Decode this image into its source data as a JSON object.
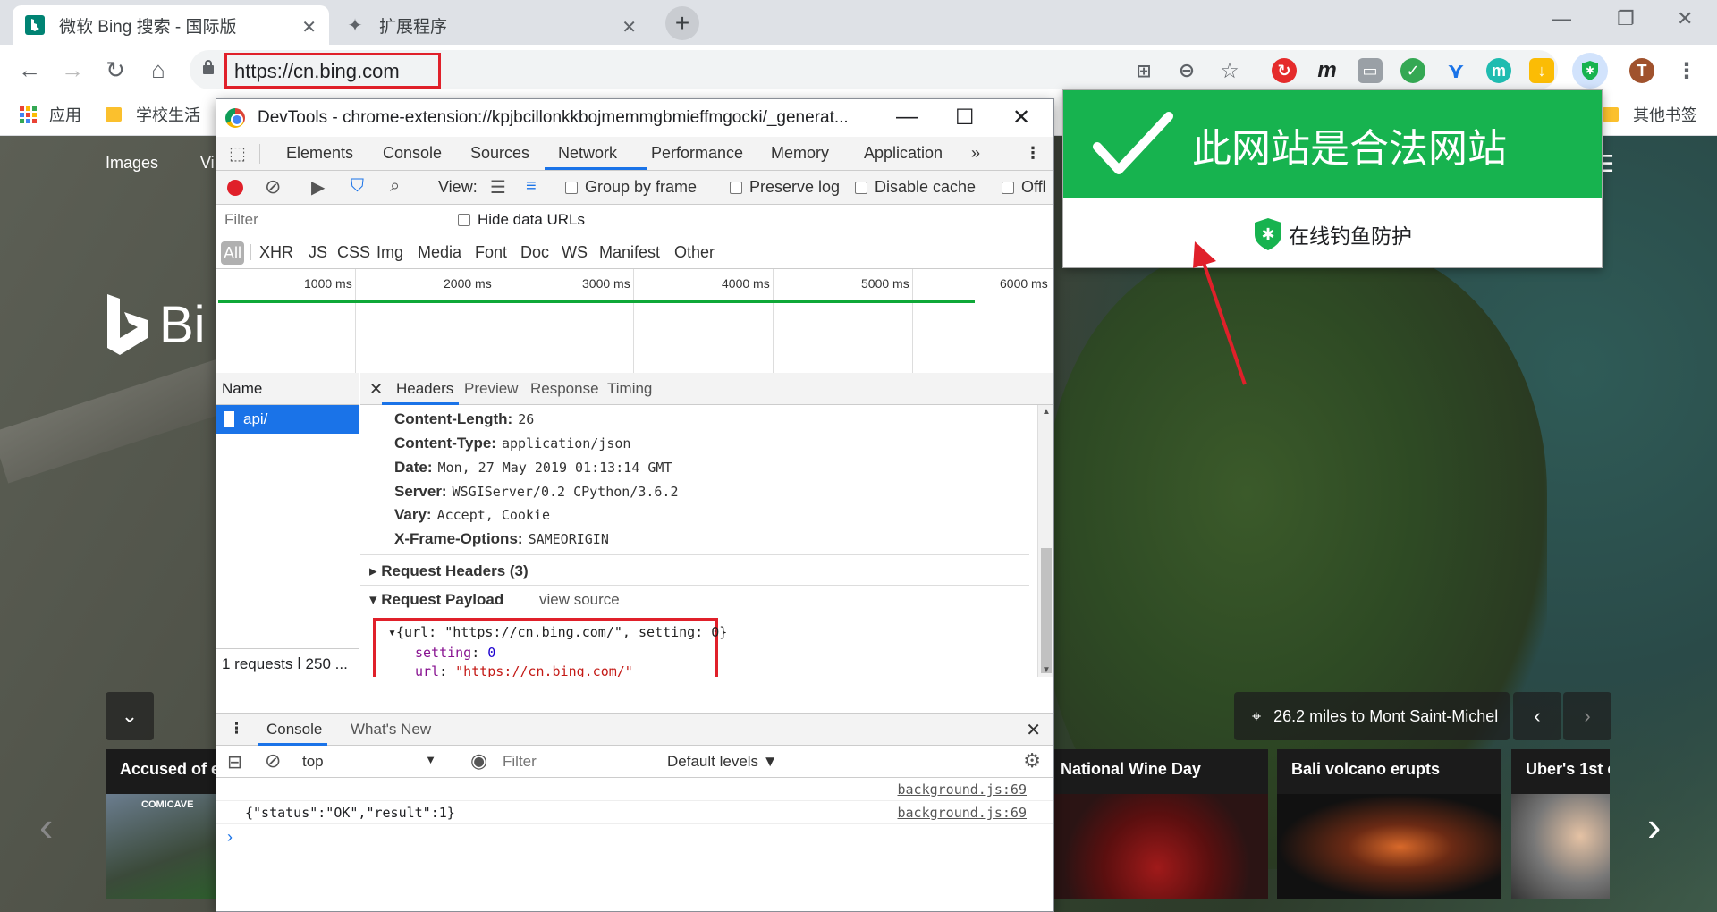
{
  "tabs": [
    {
      "title": "微软 Bing 搜索 - 国际版",
      "close": "✕"
    },
    {
      "title": "扩展程序",
      "close": "✕"
    }
  ],
  "window_controls": {
    "minimize": "—",
    "restore": "❐",
    "close": "✕"
  },
  "address_bar": {
    "url": "https://cn.bing.com"
  },
  "bookmarks": {
    "apps": "应用",
    "school": "学校生活",
    "other": "其他书签"
  },
  "profile_initial": "T",
  "bing": {
    "nav_images": "Images",
    "nav_video_partial": "Vi",
    "logo_partial": "Bi",
    "location_text": "26.2 miles to Mont Saint-Michel",
    "cards": [
      {
        "title": "Accused of el",
        "tag": "COMICAVE"
      },
      {
        "title": "National Wine Day"
      },
      {
        "title": "Bali volcano erupts"
      },
      {
        "title": "Uber's 1st e"
      }
    ]
  },
  "devtools": {
    "window_title": "DevTools - chrome-extension://kpjbcillonkkbojmemmgbmieffmgocki/_generat...",
    "tabs": [
      "Elements",
      "Console",
      "Sources",
      "Network",
      "Performance",
      "Memory",
      "Application"
    ],
    "more_tabs": "»",
    "network_toolbar": {
      "view": "View:",
      "group_by_frame": "Group by frame",
      "preserve_log": "Preserve log",
      "disable_cache": "Disable cache",
      "offline": "Offl"
    },
    "filter_placeholder": "Filter",
    "hide_data_urls": "Hide data URLs",
    "types": [
      "All",
      "XHR",
      "JS",
      "CSS",
      "Img",
      "Media",
      "Font",
      "Doc",
      "WS",
      "Manifest",
      "Other"
    ],
    "timeline_labels": [
      "1000 ms",
      "2000 ms",
      "3000 ms",
      "4000 ms",
      "5000 ms",
      "6000 ms"
    ],
    "name_header": "Name",
    "request_name": "api/",
    "summary": "1 requests ⅼ 250 ...",
    "detail_tabs": [
      "Headers",
      "Preview",
      "Response",
      "Timing"
    ],
    "response_headers": [
      {
        "key": "Content-Length:",
        "value": "26"
      },
      {
        "key": "Content-Type:",
        "value": "application/json"
      },
      {
        "key": "Date:",
        "value": "Mon, 27 May 2019 01:13:14 GMT"
      },
      {
        "key": "Server:",
        "value": "WSGIServer/0.2 CPython/3.6.2"
      },
      {
        "key": "Vary:",
        "value": "Accept, Cookie"
      },
      {
        "key": "X-Frame-Options:",
        "value": "SAMEORIGIN"
      }
    ],
    "request_headers_label": "Request Headers (3)",
    "request_payload_label": "Request Payload",
    "view_source": "view source",
    "payload": {
      "summary": "{url: \"https://cn.bing.com/\", setting: 0}",
      "setting_key": "setting",
      "setting_value": "0",
      "url_key": "url",
      "url_value": "\"https://cn.bing.com/\""
    },
    "drawer": {
      "tabs": [
        "Console",
        "What's New"
      ],
      "context": "top",
      "filter_placeholder": "Filter",
      "levels": "Default levels ▼",
      "lines": [
        {
          "text": "",
          "source": "background.js:69"
        },
        {
          "text": "{\"status\":\"OK\",\"result\":1}",
          "source": "background.js:69"
        }
      ],
      "prompt": "›"
    }
  },
  "popup": {
    "title": "此网站是合法网站",
    "subtitle": "在线钓鱼防护",
    "accent": "#17b34f"
  },
  "colors": {
    "highlight": "#e0202a",
    "selection": "#1a73e8"
  }
}
